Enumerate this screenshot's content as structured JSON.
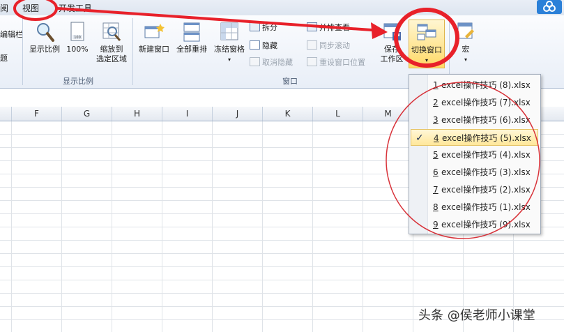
{
  "tabs": {
    "left_partial": "阅",
    "view": "视图",
    "developer": "开发工具"
  },
  "ribbon": {
    "partial_left_top": "编辑栏",
    "partial_left_bottom": "题",
    "zoom_group": {
      "zoom": "显示比例",
      "zoom100": "100%",
      "zoom_sel_line1": "缩放到",
      "zoom_sel_line2": "选定区域",
      "label": "显示比例"
    },
    "window_group": {
      "new_window": "新建窗口",
      "arrange_all": "全部重排",
      "freeze_panes": "冻结窗格",
      "split": "拆分",
      "hide": "隐藏",
      "unhide": "取消隐藏",
      "side_by_side": "并排查看",
      "sync_scroll": "同步滚动",
      "reset_position": "重设窗口位置",
      "save_line1": "保存",
      "save_line2": "工作区",
      "switch_windows": "切换窗口",
      "label": "窗口"
    },
    "macros": {
      "label": "宏"
    }
  },
  "columns": [
    "F",
    "G",
    "H",
    "I",
    "J",
    "K",
    "L",
    "M"
  ],
  "menu": {
    "items": [
      {
        "num": "1",
        "name": "excel操作技巧 (8).xlsx",
        "selected": false
      },
      {
        "num": "2",
        "name": "excel操作技巧 (7).xlsx",
        "selected": false
      },
      {
        "num": "3",
        "name": "excel操作技巧 (6).xlsx",
        "selected": false
      },
      {
        "num": "4",
        "name": "excel操作技巧 (5).xlsx",
        "selected": true
      },
      {
        "num": "5",
        "name": "excel操作技巧 (4).xlsx",
        "selected": false
      },
      {
        "num": "6",
        "name": "excel操作技巧 (3).xlsx",
        "selected": false
      },
      {
        "num": "7",
        "name": "excel操作技巧 (2).xlsx",
        "selected": false
      },
      {
        "num": "8",
        "name": "excel操作技巧 (1).xlsx",
        "selected": false
      },
      {
        "num": "9",
        "name": "excel操作技巧 (9).xlsx",
        "selected": false
      }
    ],
    "check": "✓"
  },
  "watermark": "头条 @侯老师小课堂",
  "colors": {
    "annotation_red": "#e8212a",
    "highlight": "#ffe79a",
    "ribbon_bg": "#eef3fa"
  }
}
